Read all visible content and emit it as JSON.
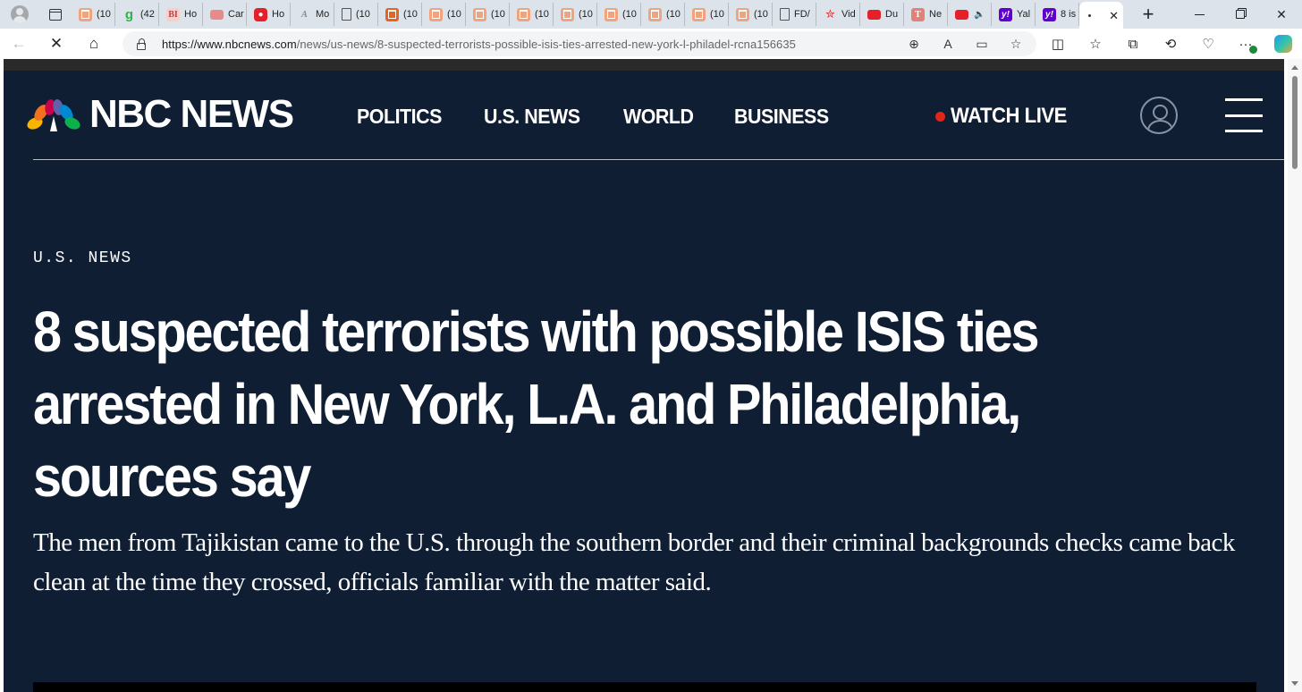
{
  "browser": {
    "tabs": [
      {
        "label": "(10",
        "icon": "substack-icon"
      },
      {
        "label": "(42",
        "icon": "grammarly-icon"
      },
      {
        "label": "Ho",
        "icon": "business-insider-icon"
      },
      {
        "label": "Car",
        "icon": "youtube-icon"
      },
      {
        "label": "Ho",
        "icon": "news-icon"
      },
      {
        "label": "Mo",
        "icon": "ai-icon"
      },
      {
        "label": "(10",
        "icon": "document-icon"
      },
      {
        "label": "(10",
        "icon": "substack-icon"
      },
      {
        "label": "(10",
        "icon": "substack-icon"
      },
      {
        "label": "(10",
        "icon": "substack-icon"
      },
      {
        "label": "(10",
        "icon": "substack-icon"
      },
      {
        "label": "(10",
        "icon": "substack-icon"
      },
      {
        "label": "(10",
        "icon": "substack-icon"
      },
      {
        "label": "(10",
        "icon": "substack-icon"
      },
      {
        "label": "(10",
        "icon": "substack-icon"
      },
      {
        "label": "(10",
        "icon": "substack-icon"
      },
      {
        "label": "FD/",
        "icon": "document-icon"
      },
      {
        "label": "Vid",
        "icon": "star-icon"
      },
      {
        "label": "Du",
        "icon": "youtube-icon"
      },
      {
        "label": "Ne",
        "icon": "newsletter-icon"
      },
      {
        "label": "",
        "icon": "youtube-icon"
      },
      {
        "label": "Yal",
        "icon": "yahoo-icon"
      },
      {
        "label": "8 is",
        "icon": "yahoo-icon"
      }
    ],
    "active_tab": {
      "label": "",
      "status": "loading"
    },
    "url_domain": "https://www.nbcnews.com",
    "url_path": "/news/us-news/8-suspected-terrorists-possible-isis-ties-arrested-new-york-l-philadel-rcna156635"
  },
  "site": {
    "logo_text": "NBC NEWS",
    "nav": [
      "POLITICS",
      "U.S. NEWS",
      "WORLD",
      "BUSINESS"
    ],
    "watch_live": "WATCH LIVE",
    "colors": {
      "background": "#0f1e33",
      "live_dot": "#e0261b",
      "text": "#ffffff"
    }
  },
  "article": {
    "section": "U.S. NEWS",
    "headline": "8 suspected terrorists with possible ISIS ties arrested in New York, L.A. and Philadelphia, sources say",
    "dek": "The men from Tajikistan came to the U.S. through the southern border and their criminal backgrounds checks came back clean at the time they crossed, officials familiar with the matter said."
  }
}
